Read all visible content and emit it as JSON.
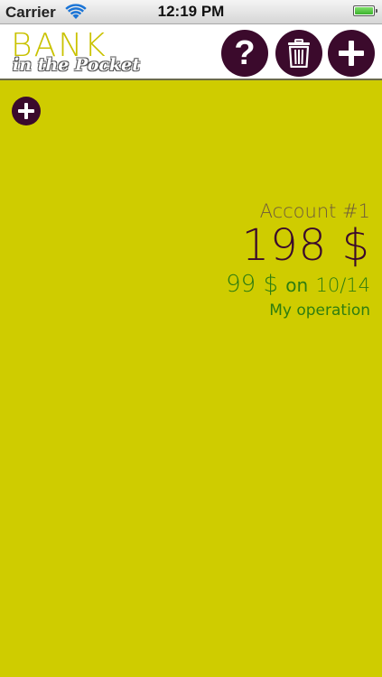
{
  "status_bar": {
    "carrier": "Carrier",
    "time": "12:19 PM",
    "icons": [
      "wifi-icon",
      "battery-icon"
    ]
  },
  "header": {
    "logo_top": "BANK",
    "logo_bottom": "in the Pocket",
    "help_label": "?",
    "buttons": [
      "help-icon",
      "trash-icon",
      "plus-icon"
    ]
  },
  "account": {
    "name": "Account #1",
    "balance": "198 $",
    "last_operation": {
      "amount": "99 $",
      "on": "on",
      "date": "10/14",
      "name": "My operation"
    }
  },
  "colors": {
    "background": "#cfcc00",
    "button": "#3b0a2c",
    "operation_text": "#2e7d10",
    "logo": "#c9c200"
  }
}
